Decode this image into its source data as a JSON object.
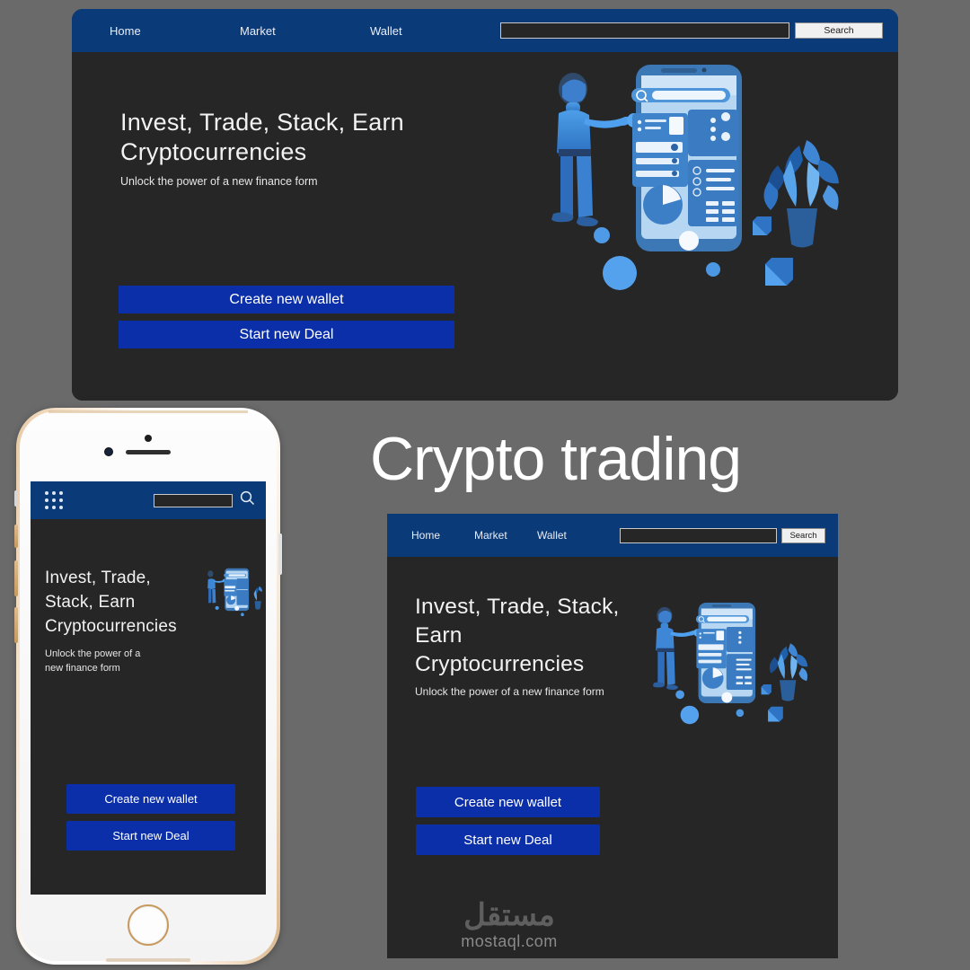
{
  "page": {
    "big_title": "Crypto trading",
    "background_color": "#6a6a6a",
    "panel_color": "#262626",
    "navbar_color": "#0a3a78",
    "cta_color": "#0b2fa8"
  },
  "nav": {
    "links": [
      {
        "label": "Home"
      },
      {
        "label": "Market"
      },
      {
        "label": "Wallet"
      }
    ],
    "search": {
      "value": "",
      "placeholder": "",
      "button_label": "Search"
    },
    "menu_icon": "grid-menu-icon",
    "search_icon": "magnifier-icon"
  },
  "hero": {
    "desktop": {
      "title_line1": "Invest, Trade, Stack, Earn",
      "title_line2": "Cryptocurrencies",
      "subtitle": "Unlock the power of a new finance form"
    },
    "tablet": {
      "title_line1": "Invest, Trade, Stack,",
      "title_line2": "Earn",
      "title_line3": "Cryptocurrencies",
      "subtitle": "Unlock the power of a new finance form"
    },
    "phone": {
      "title_line1": "Invest, Trade,",
      "title_line2": "Stack, Earn",
      "title_line3": "Cryptocurrencies",
      "subtitle_line1": "Unlock the power of a",
      "subtitle_line2": "new finance form"
    },
    "illustration": "crypto-trading-3d-illustration"
  },
  "cta": {
    "primary_label": "Create new wallet",
    "secondary_label": "Start new Deal"
  },
  "watermark": {
    "arabic": "مستقل",
    "latin": "mostaql.com"
  }
}
